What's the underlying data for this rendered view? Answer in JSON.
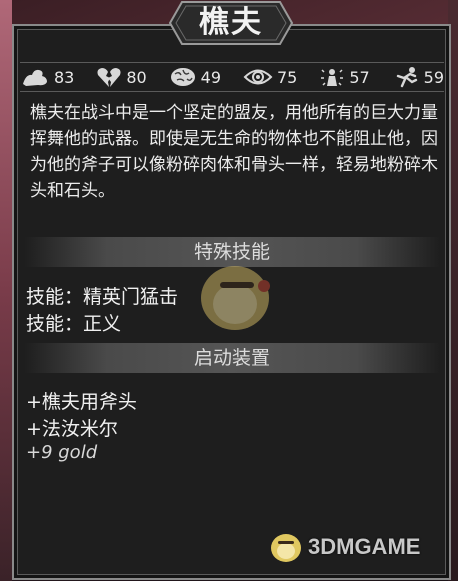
{
  "character": {
    "name": "樵夫",
    "stats": [
      {
        "icon": "strength-arm-icon",
        "value": "83"
      },
      {
        "icon": "broken-heart-icon",
        "value": "80"
      },
      {
        "icon": "brain-icon",
        "value": "49"
      },
      {
        "icon": "eye-icon",
        "value": "75"
      },
      {
        "icon": "figure-aura-icon",
        "value": "57"
      },
      {
        "icon": "running-figure-icon",
        "value": "59"
      }
    ],
    "description": "樵夫在战斗中是一个坚定的盟友，用他所有的巨大力量挥舞他的武器。即使是无生命的物体也不能阻止他，因为他的斧子可以像粉碎肉体和骨头一样，轻易地粉碎木头和石头。"
  },
  "skills": {
    "header": "特殊技能",
    "items": [
      "技能：精英门猛击",
      "技能：正义"
    ]
  },
  "gear": {
    "header": "启动装置",
    "items": [
      "+樵夫用斧头",
      "+法汝米尔"
    ],
    "gold": "+9 gold"
  },
  "watermark": {
    "text": "3DMGAME"
  },
  "colors": {
    "panel": "#1e1e1e",
    "border": "#8a8a8a",
    "text": "#ececec"
  }
}
